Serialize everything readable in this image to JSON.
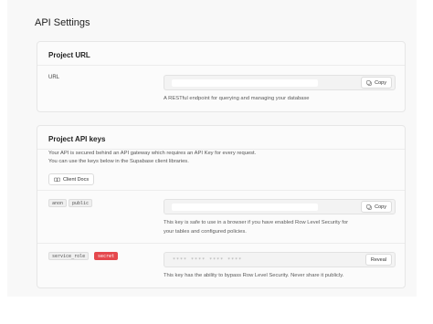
{
  "page": {
    "title": "API Settings"
  },
  "project_url": {
    "title": "Project URL",
    "url_label": "URL",
    "copy_label": "Copy",
    "help": "A RESTful endpoint for querying and managing your database"
  },
  "api_keys": {
    "title": "Project API keys",
    "description_line1": "Your API is secured behind an API gateway which requires an API Key for every request.",
    "description_line2": "You can use the keys below in the Supabase client libraries.",
    "client_docs_label": "Client Docs",
    "anon": {
      "tags": [
        "anon",
        "public"
      ],
      "copy_label": "Copy",
      "help_line1": "This key is safe to use in a browser if you have enabled Row Level Security for",
      "help_line2": "your tables and configured policies."
    },
    "service_role": {
      "tags": [
        "service_role",
        "secret"
      ],
      "masked_value": "**** **** **** ****",
      "reveal_label": "Reveal",
      "help": "This key has the ability to bypass Row Level Security. Never share it publicly."
    }
  },
  "colors": {
    "secret_badge": "#e5484d",
    "background": "#f8f8f8"
  },
  "icons": {
    "copy": "copy-icon",
    "docs": "book-icon"
  }
}
